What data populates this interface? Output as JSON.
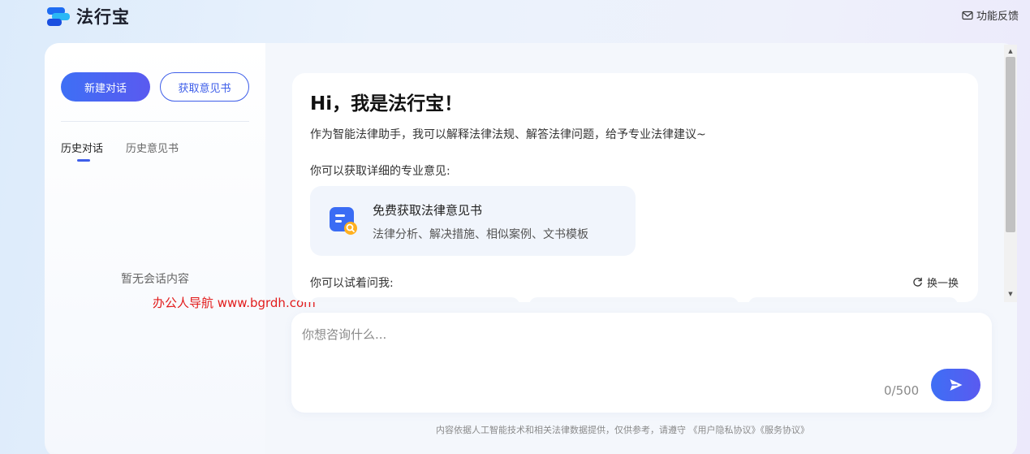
{
  "header": {
    "app_name": "法行宝",
    "feedback_label": "功能反馈"
  },
  "sidebar": {
    "new_chat_label": "新建对话",
    "get_opinion_label": "获取意见书",
    "tabs": [
      {
        "label": "历史对话",
        "active": true
      },
      {
        "label": "历史意见书",
        "active": false
      }
    ],
    "empty_text": "暂无会话内容"
  },
  "watermark": "办公人导航  www.bgrdh.com",
  "welcome": {
    "title": "Hi，我是法行宝！",
    "intro": "作为智能法律助手，我可以解释法律法规、解答法律问题，给予专业法律建议~",
    "sub_label": "你可以获取详细的专业意见:",
    "feature": {
      "title": "免费获取法律意见书",
      "description": "法律分析、解决措施、相似案例、文书模板"
    },
    "try_label": "你可以试着问我:",
    "refresh_label": "换一换"
  },
  "input": {
    "placeholder": "你想咨询什么...",
    "counter": "0/500"
  },
  "footer": {
    "disclaimer_prefix": "内容依据人工智能技术和相关法律数据提供，仅供参考，请遵守",
    "privacy_link": "《用户隐私协议》",
    "service_link": "《服务协议》"
  },
  "colors": {
    "accent": "#3e5ee9",
    "watermark": "#e21b1b"
  }
}
